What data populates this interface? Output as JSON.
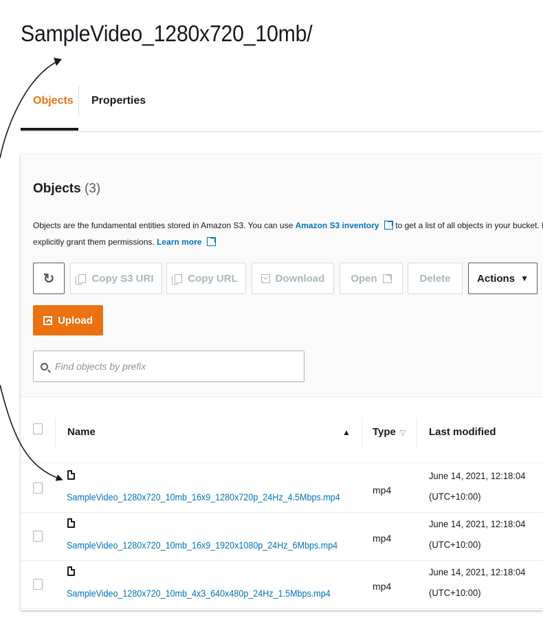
{
  "page": {
    "title": "SampleVideo_1280x720_10mb/"
  },
  "tabs": [
    {
      "label": "Objects",
      "active": true
    },
    {
      "label": "Properties",
      "active": false
    }
  ],
  "objects_panel": {
    "title": "Objects",
    "count": "(3)",
    "description_part1": "Objects are the fundamental entities stored in Amazon S3. You can use ",
    "description_link": "Amazon S3 inventory",
    "description_part2": " to get a list of all objects in your bucket. For others",
    "description_line2": "explicitly grant them permissions. ",
    "learn_more": "Learn more"
  },
  "toolbar": {
    "refresh_icon": "refresh-icon",
    "copy_s3_uri": "Copy S3 URI",
    "copy_url": "Copy URL",
    "download": "Download",
    "open": "Open",
    "delete": "Delete",
    "actions": "Actions",
    "upload": "Upload"
  },
  "search": {
    "placeholder": "Find objects by prefix"
  },
  "table": {
    "columns": {
      "name": "Name",
      "type": "Type",
      "last_modified": "Last modified"
    },
    "rows": [
      {
        "name": "SampleVideo_1280x720_10mb_16x9_1280x720p_24Hz_4.5Mbps.mp4",
        "type": "mp4",
        "modified_line1": "June 14, 2021, 12:18:04",
        "modified_line2": "(UTC+10:00)"
      },
      {
        "name": "SampleVideo_1280x720_10mb_16x9_1920x1080p_24Hz_6Mbps.mp4",
        "type": "mp4",
        "modified_line1": "June 14, 2021, 12:18:04",
        "modified_line2": "(UTC+10:00)"
      },
      {
        "name": "SampleVideo_1280x720_10mb_4x3_640x480p_24Hz_1.5Mbps.mp4",
        "type": "mp4",
        "modified_line1": "June 14, 2021, 12:18:04",
        "modified_line2": "(UTC+10:00)"
      }
    ]
  },
  "colors": {
    "accent": "#ec7211",
    "link": "#0073bb",
    "text": "#16191f"
  }
}
